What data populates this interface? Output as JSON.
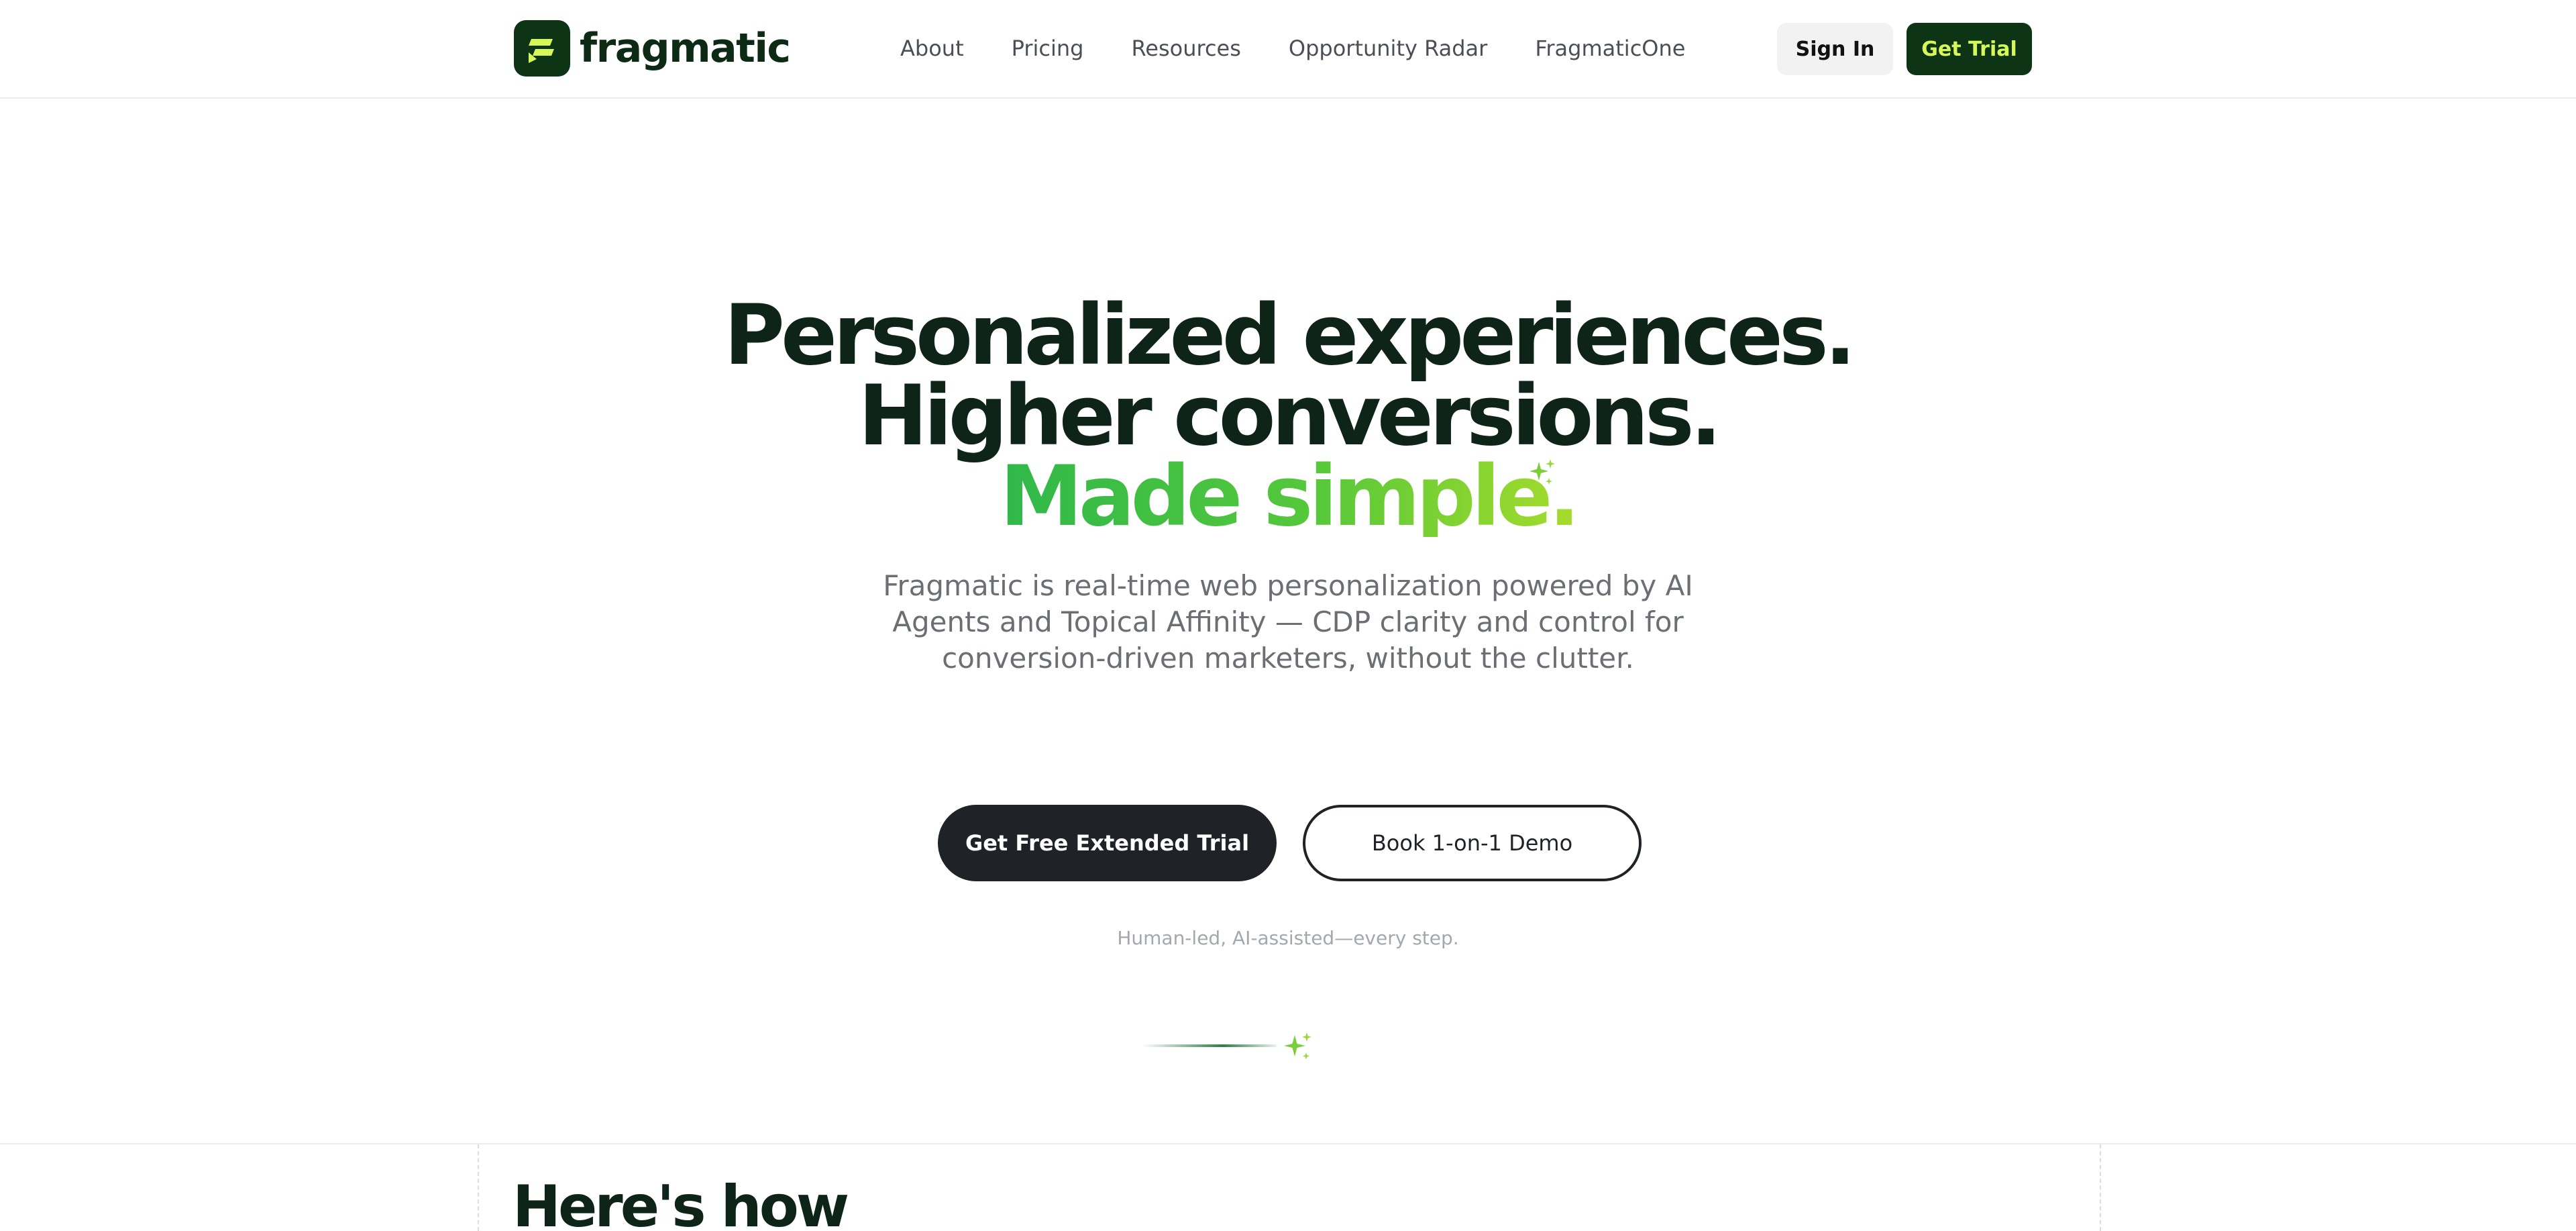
{
  "header": {
    "brand_name": "fragmatic",
    "logo_icon": "fragmatic-logo-icon",
    "nav": [
      {
        "label": "About"
      },
      {
        "label": "Pricing"
      },
      {
        "label": "Resources"
      },
      {
        "label": "Opportunity Radar"
      },
      {
        "label": "FragmaticOne"
      }
    ],
    "sign_in_label": "Sign In",
    "get_trial_label": "Get Trial"
  },
  "hero": {
    "headline_line1": "Personalized experiences.",
    "headline_line2": "Higher conversions.",
    "headline_line3": "Made simple.",
    "subheading": "Fragmatic is real-time web personalization powered by AI Agents and Topical Affinity — CDP clarity and control for conversion-driven marketers, without the clutter.",
    "primary_cta_label": "Get Free Extended Trial",
    "secondary_cta_label": "Book 1-on-1 Demo",
    "note": "Human-led, AI-assisted—every step.",
    "sparkle_icon": "sparkle-icon"
  },
  "next_section": {
    "title": "Here's how"
  },
  "colors": {
    "brand_dark_green": "#0d3415",
    "brand_lime": "#d6f75a",
    "accent_gradient_start": "#2fb84a",
    "accent_gradient_end": "#a6dc2b",
    "headline": "#0f2419",
    "primary_button": "#1f2227"
  }
}
